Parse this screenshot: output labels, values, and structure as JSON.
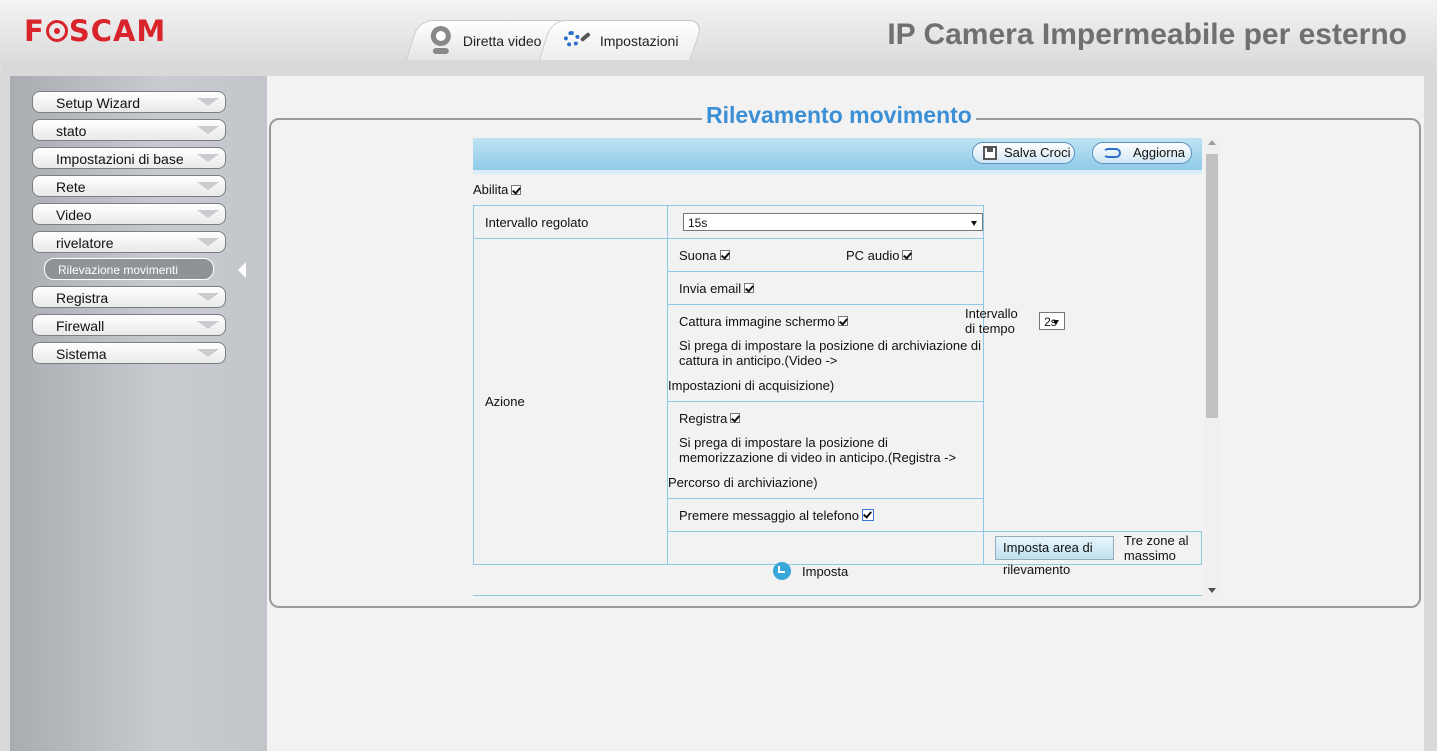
{
  "header": {
    "logo": "FOSCAM",
    "camera_title": "IP Camera Impermeabile per esterno",
    "tabs": [
      {
        "label": "Diretta video",
        "icon": "webcam-icon"
      },
      {
        "label": "Impostazioni",
        "icon": "settings-gears-icon"
      }
    ]
  },
  "sidebar": {
    "items": [
      {
        "label": "Setup Wizard"
      },
      {
        "label": "stato"
      },
      {
        "label": "Impostazioni di base"
      },
      {
        "label": "Rete"
      },
      {
        "label": "Video"
      },
      {
        "label": "rivelatore"
      },
      {
        "label": "Registra"
      },
      {
        "label": "Firewall"
      },
      {
        "label": "Sistema"
      }
    ],
    "active_subitem": "Rilevazione movimenti"
  },
  "page": {
    "title": "Rilevamento movimento",
    "toolbar": {
      "save_label": "Salva Croci",
      "refresh_label": "Aggiorna"
    },
    "enable_label": "Abilita",
    "enable_checked": true,
    "interval_label": "Intervallo regolato",
    "interval_value": "15s",
    "action_label": "Azione",
    "sound_label": "Suona",
    "pc_audio_label": "PC audio",
    "email_label": "Invia email",
    "snapshot_label": "Cattura immagine schermo",
    "time_interval_label": "Intervallo di tempo",
    "time_interval_value": "2s",
    "snapshot_note_1": "Si prega di impostare la posizione di archiviazione di cattura in anticipo.(Video ->",
    "snapshot_note_2": "Impostazioni di acquisizione)",
    "record_label": "Registra",
    "record_note_1": "Si prega di impostare la posizione di memorizzazione di video in anticipo.(Registra ->",
    "record_note_2": "Percorso di archiviazione)",
    "push_label": "Premere messaggio al telefono",
    "area_button": "Imposta area di rilevamento",
    "area_note": "Tre zone al massimo",
    "schedule_label": "Imposta"
  }
}
